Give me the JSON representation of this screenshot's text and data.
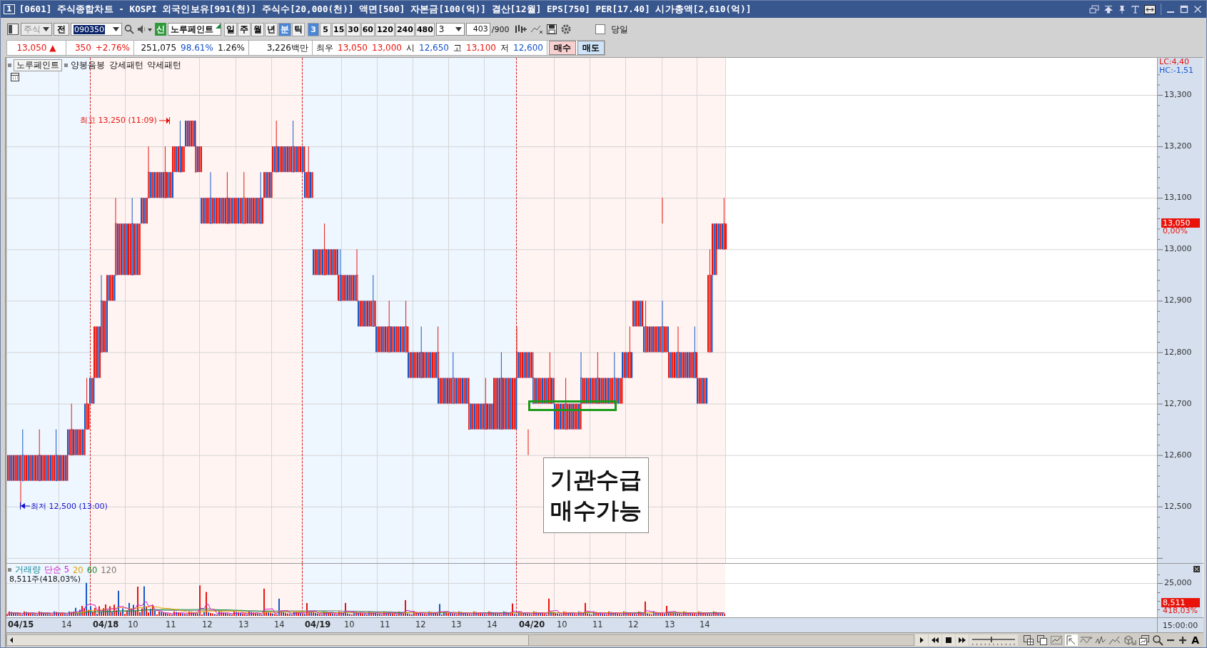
{
  "window": {
    "number": "1",
    "title": "[0601] 주식종합차트 - KOSPI 외국인보유[991(천)] 주식수[20,000(천)] 액면[500] 자본금[100(억)] 결산[12월] EPS[750] PER[17.40] 시가총액[2,610(억)]"
  },
  "toolbar": {
    "market": "주식",
    "all_button": "전",
    "code": "090350",
    "new_badge": "신",
    "stock_name": "노루페인트",
    "periods": [
      {
        "label": "일",
        "selected": false
      },
      {
        "label": "주",
        "selected": false
      },
      {
        "label": "월",
        "selected": false
      },
      {
        "label": "년",
        "selected": false
      },
      {
        "label": "분",
        "selected": true
      },
      {
        "label": "틱",
        "selected": false
      }
    ],
    "intervals": [
      {
        "label": "3",
        "selected": true
      },
      {
        "label": "5",
        "selected": false
      },
      {
        "label": "15",
        "selected": false
      },
      {
        "label": "30",
        "selected": false
      },
      {
        "label": "60",
        "selected": false
      },
      {
        "label": "120",
        "selected": false
      },
      {
        "label": "240",
        "selected": false
      },
      {
        "label": "480",
        "selected": false
      }
    ],
    "interval_combo": "3",
    "count": "403",
    "count_max": "/900",
    "today": {
      "label": "당일",
      "checked": false
    }
  },
  "quote": [
    {
      "items": [
        {
          "text": "13,050 ▲",
          "kind": "up"
        }
      ]
    },
    {
      "items": [
        {
          "text": "350",
          "kind": "up"
        },
        {
          "text": "+2.76%",
          "kind": "up"
        }
      ]
    },
    {
      "items": [
        {
          "text": "251,075",
          "kind": "plain"
        },
        {
          "text": "98.61%",
          "kind": "down"
        },
        {
          "text": "1.26%",
          "kind": "plain"
        }
      ]
    },
    {
      "items": [
        {
          "text": "3,226백만",
          "kind": "plain"
        }
      ]
    },
    {
      "items": [
        {
          "text": "최우",
          "kind": "plain"
        },
        {
          "text": "13,050",
          "kind": "up"
        },
        {
          "text": "13,000",
          "kind": "up"
        },
        {
          "text": "시",
          "kind": "plain"
        },
        {
          "text": "12,650",
          "kind": "down"
        },
        {
          "text": "고",
          "kind": "plain"
        },
        {
          "text": "13,100",
          "kind": "up"
        },
        {
          "text": "저",
          "kind": "plain"
        },
        {
          "text": "12,600",
          "kind": "down"
        }
      ]
    }
  ],
  "order_buttons": [
    {
      "label": "매수",
      "kind": "buy"
    },
    {
      "label": "매도",
      "kind": "sell"
    }
  ],
  "price_panel": {
    "legend_name": "노루페인트",
    "legend_patterns": "양봉음봉 강세패턴 약세패턴",
    "high_marker": "최고 13,250 (11:09)",
    "low_marker": "최저 12,500 (13:00)",
    "note_lines": [
      "기관수급",
      "매수가능"
    ],
    "lc": "LC:4,40",
    "hc": "HC:-1,51",
    "ticks": [
      "13,300",
      "13,200",
      "13,100",
      "13,000",
      "12,900",
      "12,800",
      "12,700",
      "12,600",
      "12,500"
    ],
    "current_price": "13,050",
    "current_change": "0,00%"
  },
  "volume_panel": {
    "legend": [
      {
        "label": "거래량",
        "kind": "volume"
      },
      {
        "label": "단순 5",
        "kind": "ma5"
      },
      {
        "label": "20",
        "kind": "ma20"
      },
      {
        "label": "60",
        "kind": "ma60"
      },
      {
        "label": "120",
        "kind": "ma120"
      }
    ],
    "summary": "8,511주(418,03%)",
    "tick": "25,000",
    "current": "8,511",
    "current_ratio": "418,03%"
  },
  "time_axis": {
    "labels": [
      {
        "text": "04/15",
        "kind": "date"
      },
      {
        "text": "14",
        "kind": "hour"
      },
      {
        "text": "04/18",
        "kind": "date"
      },
      {
        "text": "10",
        "kind": "hour"
      },
      {
        "text": "11",
        "kind": "hour"
      },
      {
        "text": "12",
        "kind": "hour"
      },
      {
        "text": "13",
        "kind": "hour"
      },
      {
        "text": "14",
        "kind": "hour"
      },
      {
        "text": "04/19",
        "kind": "date"
      },
      {
        "text": "10",
        "kind": "hour"
      },
      {
        "text": "11",
        "kind": "hour"
      },
      {
        "text": "12",
        "kind": "hour"
      },
      {
        "text": "13",
        "kind": "hour"
      },
      {
        "text": "14",
        "kind": "hour"
      },
      {
        "text": "04/20",
        "kind": "date"
      },
      {
        "text": "10",
        "kind": "hour"
      },
      {
        "text": "11",
        "kind": "hour"
      },
      {
        "text": "12",
        "kind": "hour"
      },
      {
        "text": "13",
        "kind": "hour"
      },
      {
        "text": "14",
        "kind": "hour"
      }
    ],
    "end_time": "15:00:00"
  },
  "footer": {
    "font_button": "A",
    "speed": {
      "level": 0.45
    }
  }
}
